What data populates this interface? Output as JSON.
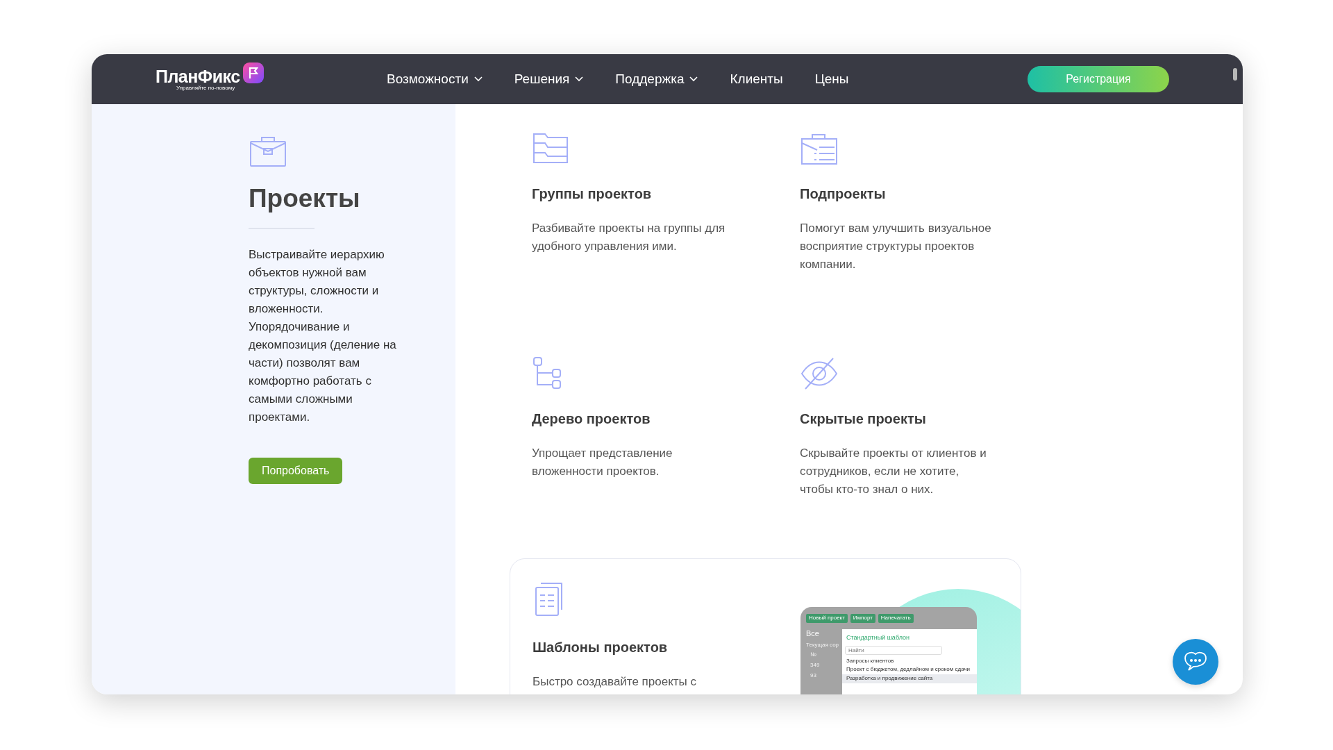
{
  "header": {
    "logo": {
      "name": "ПланФикс",
      "tagline": "Управляйте по-новому"
    },
    "nav": [
      {
        "label": "Возможности",
        "dropdown": true
      },
      {
        "label": "Решения",
        "dropdown": true
      },
      {
        "label": "Поддержка",
        "dropdown": true
      },
      {
        "label": "Клиенты",
        "dropdown": false
      },
      {
        "label": "Цены",
        "dropdown": false
      }
    ],
    "register_button": "Регистрация"
  },
  "intro": {
    "title": "Проекты",
    "text": "Выстраивайте иерархию объектов нужной вам структуры, сложности и вложенности. Упорядочивание и декомпозиция (деление на части) позволят вам комфортно работать с самыми сложными проектами.",
    "button": "Попробовать"
  },
  "features": [
    {
      "kind": "folder",
      "title": "Группы проектов",
      "text": "Разбивайте проекты на группы для удобного управления ими."
    },
    {
      "kind": "subprojects",
      "title": "Подпроекты",
      "text": "Помогут вам улучшить визуальное восприятие структуры проектов компании."
    },
    {
      "kind": "tree",
      "title": "Дерево проектов",
      "text": "Упрощает представление вложенности проектов."
    },
    {
      "kind": "hidden",
      "title": "Скрытые проекты",
      "text": "Скрывайте проекты от клиентов и сотрудников, если не хотите, чтобы кто-то знал о них."
    }
  ],
  "template_card": {
    "title": "Шаблоны проектов",
    "text": "Быстро создавайте проекты с",
    "mockup": {
      "toolbar": [
        "Новый проект",
        "Импорт",
        "Напечатать"
      ],
      "filter": "Все",
      "sort_label": "Текущая сор",
      "column": "№",
      "rows": [
        "349",
        "93"
      ],
      "dropdown": {
        "title": "Стандартный шаблон",
        "search_placeholder": "Найти",
        "items": [
          {
            "label": "Запросы клиентов",
            "selected": false
          },
          {
            "label": "Проект с бюджетом, дедлайном и сроком сдачи",
            "selected": false
          },
          {
            "label": "Разработка и продвижение сайта",
            "selected": true
          }
        ]
      }
    }
  }
}
